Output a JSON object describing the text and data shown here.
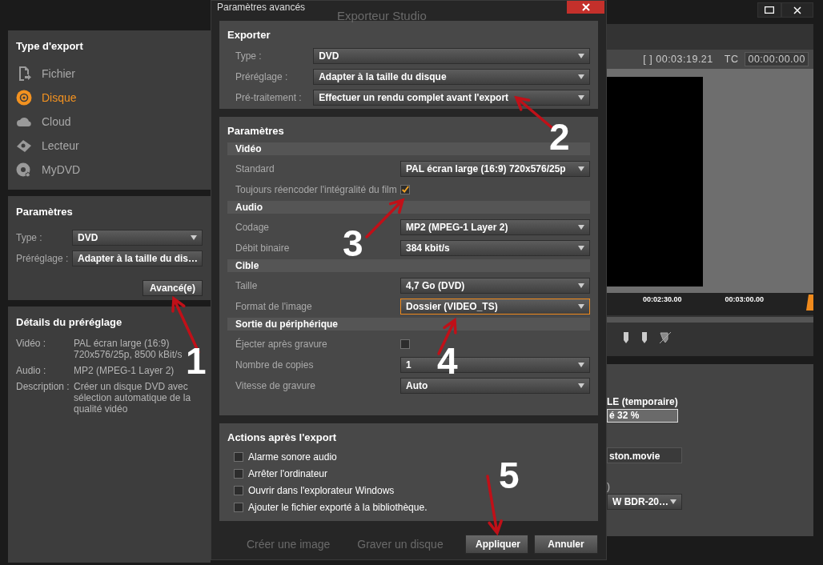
{
  "export_type": {
    "title": "Type d'export",
    "items": [
      {
        "label": "Fichier",
        "selected": false
      },
      {
        "label": "Disque",
        "selected": true
      },
      {
        "label": "Cloud",
        "selected": false
      },
      {
        "label": "Lecteur",
        "selected": false
      },
      {
        "label": "MyDVD",
        "selected": false
      }
    ]
  },
  "parameters": {
    "title": "Paramètres",
    "fields": [
      {
        "label": "Type :",
        "value": "DVD"
      },
      {
        "label": "Préréglage :",
        "value": "Adapter à la taille du dis…"
      }
    ],
    "advanced_button": "Avancé(e)"
  },
  "preset_details": {
    "title": "Détails du préréglage",
    "rows": [
      {
        "label": "Vidéo :",
        "value": "PAL écran large (16:9) 720x576/25p, 8500 kBit/s"
      },
      {
        "label": "Audio :",
        "value": "MP2 (MPEG-1 Layer 2)"
      },
      {
        "label": "Description :",
        "value": "Créer un disque DVD avec sélection automatique de la qualité vidéo"
      }
    ]
  },
  "dialog": {
    "title": "Paramètres avancés",
    "behind_title": "Exporteur Studio",
    "exporter": {
      "title": "Exporter",
      "rows": [
        {
          "label": "Type :",
          "value": "DVD"
        },
        {
          "label": "Préréglage :",
          "value": "Adapter à la taille du disque"
        },
        {
          "label": "Pré-traitement :",
          "value": "Effectuer un rendu complet avant l'export"
        }
      ]
    },
    "parameters": {
      "title": "Paramètres",
      "groups": [
        {
          "title": "Vidéo",
          "rows": [
            {
              "kind": "select",
              "label": "Standard",
              "value": "PAL écran large (16:9) 720x576/25p",
              "focused": false
            },
            {
              "kind": "checkbox",
              "label": "Toujours réencoder l'intégralité du film",
              "checked": true
            }
          ]
        },
        {
          "title": "Audio",
          "rows": [
            {
              "kind": "select",
              "label": "Codage",
              "value": "MP2 (MPEG-1 Layer 2)",
              "focused": false
            },
            {
              "kind": "select",
              "label": "Débit binaire",
              "value": "384 kbit/s",
              "focused": false
            }
          ]
        },
        {
          "title": "Cible",
          "rows": [
            {
              "kind": "select",
              "label": "Taille",
              "value": "4,7 Go (DVD)",
              "focused": false
            },
            {
              "kind": "select",
              "label": "Format de l'image",
              "value": "Dossier (VIDEO_TS)",
              "focused": true
            }
          ]
        },
        {
          "title": "Sortie du périphérique",
          "rows": [
            {
              "kind": "checkbox",
              "label": "Éjecter après gravure",
              "checked": false
            },
            {
              "kind": "select",
              "label": "Nombre de copies",
              "value": "1",
              "focused": false
            },
            {
              "kind": "select",
              "label": "Vitesse de gravure",
              "value": "Auto",
              "focused": false
            }
          ]
        }
      ]
    },
    "after_export": {
      "title": "Actions après l'export",
      "options": [
        {
          "label": "Alarme sonore audio",
          "checked": false
        },
        {
          "label": "Arrêter l'ordinateur",
          "checked": false
        },
        {
          "label": "Ouvrir dans l'explorateur Windows",
          "checked": false
        },
        {
          "label": "Ajouter le fichier exporté à la bibliothèque.",
          "checked": false
        }
      ]
    },
    "behind_actions": [
      "Créer une image",
      "Graver un disque"
    ],
    "buttons": [
      "Appliquer",
      "Annuler"
    ]
  },
  "preview": {
    "duration": "[ ] 00:03:19.21",
    "tc_label": "TC",
    "timecode": "00:00:00.00",
    "timeline_labels": [
      "00:02:30.00",
      "00:03:00.00"
    ]
  },
  "output": {
    "disc_label": "LE (temporaire)",
    "usage": "é 32 %",
    "filename": "ston.movie",
    "device_label": ")",
    "device": "W  BDR-20…"
  },
  "annotations": [
    {
      "label": "1"
    },
    {
      "label": "2"
    },
    {
      "label": "3"
    },
    {
      "label": "4"
    },
    {
      "label": "5"
    }
  ]
}
